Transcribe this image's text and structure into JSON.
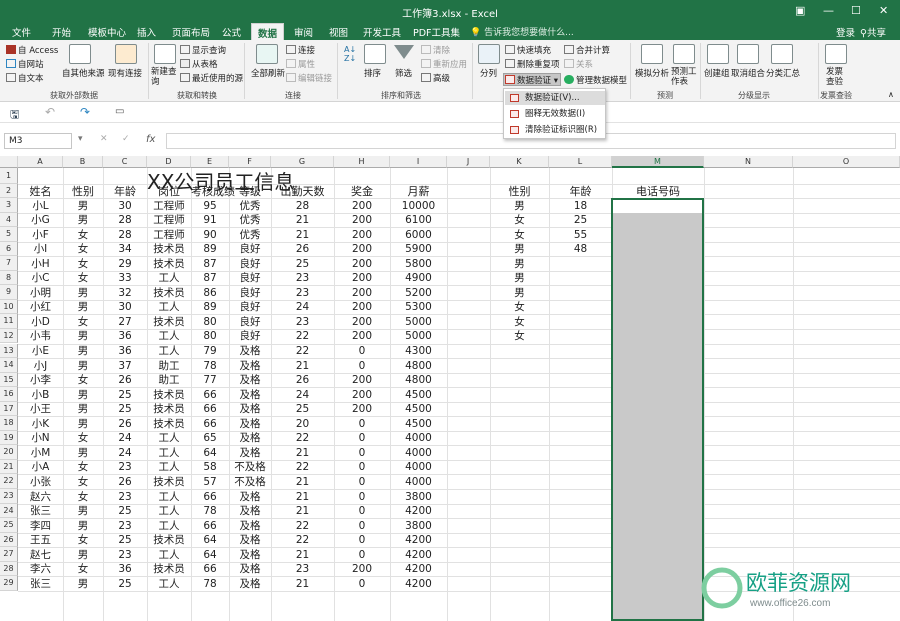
{
  "title": "工作簿3.xlsx - Excel",
  "window_controls": {
    "restore": "▣",
    "minimize": "—",
    "maximize": "☐",
    "close": "✕"
  },
  "tabs": [
    {
      "label": "文件"
    },
    {
      "label": "开始"
    },
    {
      "label": "模板中心"
    },
    {
      "label": "插入"
    },
    {
      "label": "页面布局"
    },
    {
      "label": "公式"
    },
    {
      "label": "数据"
    },
    {
      "label": "审阅"
    },
    {
      "label": "视图"
    },
    {
      "label": "开发工具"
    },
    {
      "label": "PDF工具集"
    }
  ],
  "active_tab": "数据",
  "tellme": "告诉我您想要做什么...",
  "login": "登录",
  "share": "共享",
  "ribbon": {
    "get_external": {
      "access": "自 Access",
      "web": "自网站",
      "text": "自文本",
      "other": "自其他来源",
      "existing": "现有连接",
      "label": "获取外部数据"
    },
    "transform": {
      "new_query": "新建查询",
      "show_queries": "显示查询",
      "from_table": "从表格",
      "recent": "最近使用的源",
      "label": "获取和转换"
    },
    "connections": {
      "refresh": "全部刷新",
      "connections": "连接",
      "properties": "属性",
      "edit_links": "编辑链接",
      "label": "连接"
    },
    "sort_filter": {
      "sort": "排序",
      "filter": "筛选",
      "clear": "清除",
      "reapply": "重新应用",
      "advanced": "高级",
      "label": "排序和筛选"
    },
    "data_tools": {
      "split": "分列",
      "flash_fill": "快速填充",
      "remove_dup": "删除重复项",
      "validation": "数据验证",
      "consolidate": "合并计算",
      "relations": "关系",
      "manage_model": "管理数据模型"
    },
    "forecast": {
      "whatif": "模拟分析",
      "forecast": "预测工作表",
      "label": "预测"
    },
    "outline": {
      "group": "创建组",
      "ungroup": "取消组合",
      "subtotal": "分类汇总",
      "label": "分级显示"
    },
    "invoice": {
      "check": "发票查验",
      "label": "发票查验"
    }
  },
  "dropdown": [
    "数据验证(V)...",
    "圈释无效数据(I)",
    "清除验证标识圈(R)"
  ],
  "name_box": "M3",
  "fx": "fx",
  "columns": [
    "A",
    "B",
    "C",
    "D",
    "E",
    "F",
    "G",
    "H",
    "I",
    "J",
    "K",
    "L",
    "M",
    "N",
    "O"
  ],
  "sheet_title": "XX公司员工信息",
  "headers": [
    "姓名",
    "性别",
    "年龄",
    "岗位",
    "考核成绩",
    "等级",
    "出勤天数",
    "奖金",
    "月薪"
  ],
  "rows": [
    [
      "小L",
      "男",
      "30",
      "工程师",
      "95",
      "优秀",
      "28",
      "200",
      "10000"
    ],
    [
      "小G",
      "男",
      "28",
      "工程师",
      "91",
      "优秀",
      "21",
      "200",
      "6100"
    ],
    [
      "小F",
      "女",
      "28",
      "工程师",
      "90",
      "优秀",
      "21",
      "200",
      "6000"
    ],
    [
      "小I",
      "女",
      "34",
      "技术员",
      "89",
      "良好",
      "26",
      "200",
      "5900"
    ],
    [
      "小H",
      "女",
      "29",
      "技术员",
      "87",
      "良好",
      "25",
      "200",
      "5800"
    ],
    [
      "小C",
      "女",
      "33",
      "工人",
      "87",
      "良好",
      "23",
      "200",
      "4900"
    ],
    [
      "小明",
      "男",
      "32",
      "技术员",
      "86",
      "良好",
      "23",
      "200",
      "5200"
    ],
    [
      "小红",
      "男",
      "30",
      "工人",
      "89",
      "良好",
      "24",
      "200",
      "5300"
    ],
    [
      "小D",
      "女",
      "27",
      "技术员",
      "80",
      "良好",
      "23",
      "200",
      "5000"
    ],
    [
      "小韦",
      "男",
      "36",
      "工人",
      "80",
      "良好",
      "22",
      "200",
      "5000"
    ],
    [
      "小E",
      "男",
      "36",
      "工人",
      "79",
      "及格",
      "22",
      "0",
      "4300"
    ],
    [
      "小J",
      "男",
      "37",
      "助工",
      "78",
      "及格",
      "21",
      "0",
      "4800"
    ],
    [
      "小李",
      "女",
      "26",
      "助工",
      "77",
      "及格",
      "26",
      "200",
      "4800"
    ],
    [
      "小B",
      "男",
      "25",
      "技术员",
      "66",
      "及格",
      "24",
      "200",
      "4500"
    ],
    [
      "小王",
      "男",
      "25",
      "技术员",
      "66",
      "及格",
      "25",
      "200",
      "4500"
    ],
    [
      "小K",
      "男",
      "26",
      "技术员",
      "66",
      "及格",
      "20",
      "0",
      "4500"
    ],
    [
      "小N",
      "女",
      "24",
      "工人",
      "65",
      "及格",
      "22",
      "0",
      "4000"
    ],
    [
      "小M",
      "男",
      "24",
      "工人",
      "64",
      "及格",
      "21",
      "0",
      "4000"
    ],
    [
      "小A",
      "女",
      "23",
      "工人",
      "58",
      "不及格",
      "22",
      "0",
      "4000"
    ],
    [
      "小张",
      "女",
      "26",
      "技术员",
      "57",
      "不及格",
      "21",
      "0",
      "4000"
    ],
    [
      "赵六",
      "女",
      "23",
      "工人",
      "66",
      "及格",
      "21",
      "0",
      "3800"
    ],
    [
      "张三",
      "男",
      "25",
      "工人",
      "78",
      "及格",
      "21",
      "0",
      "4200"
    ],
    [
      "李四",
      "男",
      "23",
      "工人",
      "66",
      "及格",
      "22",
      "0",
      "3800"
    ],
    [
      "王五",
      "女",
      "25",
      "技术员",
      "64",
      "及格",
      "22",
      "0",
      "4200"
    ],
    [
      "赵七",
      "男",
      "23",
      "工人",
      "64",
      "及格",
      "21",
      "0",
      "4200"
    ],
    [
      "李六",
      "女",
      "36",
      "技术员",
      "66",
      "及格",
      "23",
      "200",
      "4200"
    ],
    [
      "张三",
      "男",
      "25",
      "工人",
      "78",
      "及格",
      "21",
      "0",
      "4200"
    ]
  ],
  "side": {
    "header_gender": "性别",
    "header_age": "年龄",
    "header_phone": "电话号码",
    "genders": [
      "男",
      "女",
      "女",
      "男",
      "男",
      "男",
      "男",
      "女",
      "女",
      "女"
    ],
    "ages": [
      "18",
      "25",
      "55",
      "48"
    ]
  },
  "watermark": {
    "text": "欧菲资源网",
    "url": "www.office26.com"
  },
  "colors": {
    "excel_green": "#217346",
    "selection": "#c9c9c9"
  }
}
